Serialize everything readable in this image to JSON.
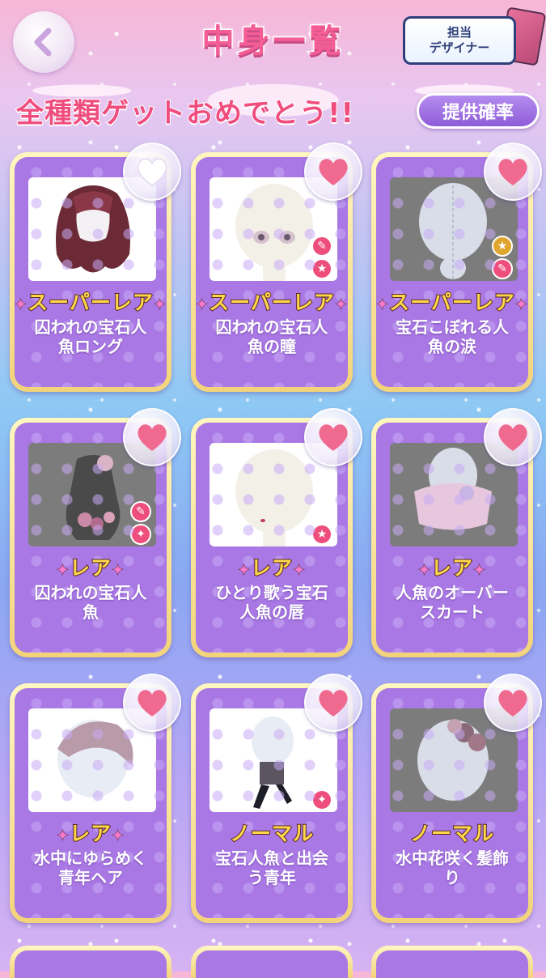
{
  "header": {
    "title": "中身一覧",
    "designer_line1": "担当",
    "designer_line2": "デザイナー"
  },
  "banner": {
    "text": "全種類ゲットおめでとう!!",
    "rate_button": "提供確率"
  },
  "items": [
    {
      "rarity": "スーパーレア",
      "name_line1": "囚われの宝石人",
      "name_line2": "魚ロング",
      "favorited": false
    },
    {
      "rarity": "スーパーレア",
      "name_line1": "囚われの宝石人",
      "name_line2": "魚の瞳",
      "favorited": true
    },
    {
      "rarity": "スーパーレア",
      "name_line1": "宝石こぼれる人",
      "name_line2": "魚の涙",
      "favorited": true
    },
    {
      "rarity": "レア",
      "name_line1": "囚われの宝石人",
      "name_line2": "魚",
      "favorited": true
    },
    {
      "rarity": "レア",
      "name_line1": "ひとり歌う宝石",
      "name_line2": "人魚の唇",
      "favorited": true
    },
    {
      "rarity": "レア",
      "name_line1": "人魚のオーバー",
      "name_line2": "スカート",
      "favorited": true
    },
    {
      "rarity": "レア",
      "name_line1": "水中にゆらめく",
      "name_line2": "青年ヘア",
      "favorited": true
    },
    {
      "rarity": "ノーマル",
      "name_line1": "宝石人魚と出会",
      "name_line2": "う青年",
      "favorited": true
    },
    {
      "rarity": "ノーマル",
      "name_line1": "水中花咲く髪飾",
      "name_line2": "り",
      "favorited": true
    }
  ],
  "colors": {
    "heart_active": "#f0698f",
    "heart_inactive": "#ffffff",
    "card_purple": "#a978e4",
    "title_pink": "#f45d95"
  }
}
